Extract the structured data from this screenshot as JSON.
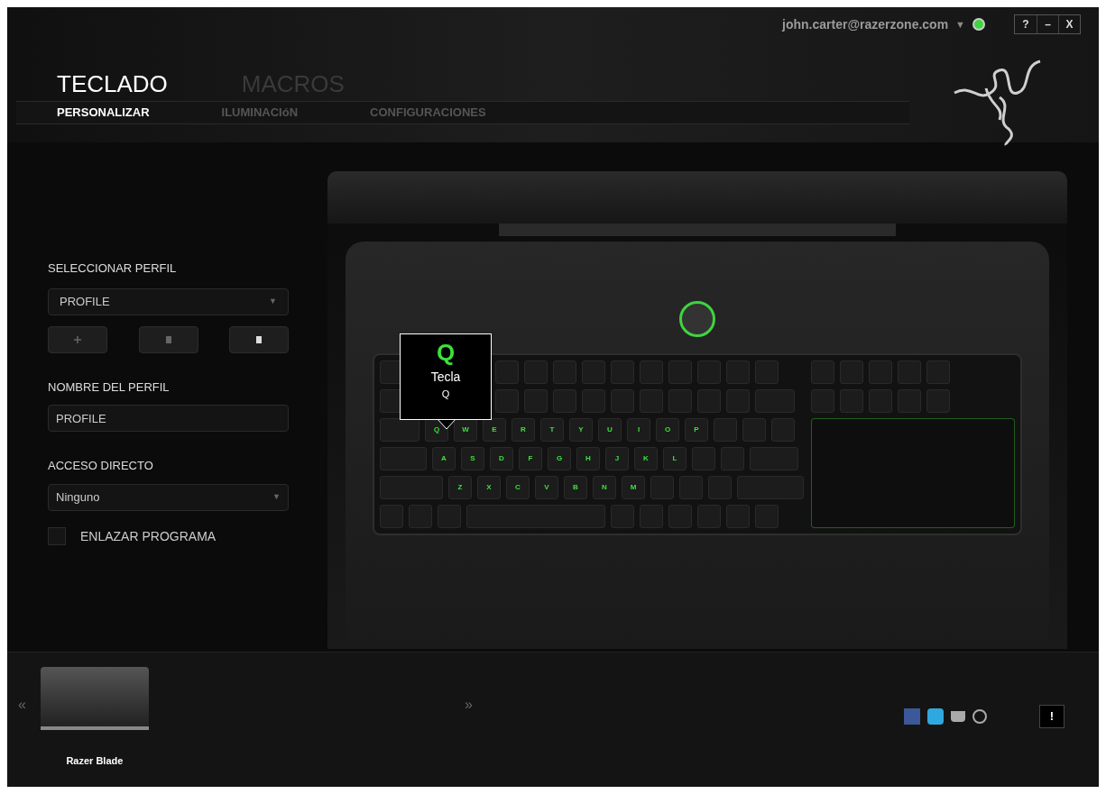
{
  "account": {
    "email": "john.carter@razerzone.com",
    "online": true
  },
  "account_caret": "▼",
  "dropdown_caret": "▼",
  "window_buttons": [
    "?",
    "–",
    "X"
  ],
  "tabs": [
    {
      "label": "TECLADO",
      "selected": true
    },
    {
      "label": "MACROS",
      "selected": false
    }
  ],
  "subtabs": [
    {
      "label": "PERSONALIZAR",
      "selected": true
    },
    {
      "label": "ILUMINACIóN",
      "selected": false
    },
    {
      "label": "CONFIGURACIONES",
      "selected": false
    }
  ],
  "profile": {
    "select_label": "SELECCIONAR PERFIL",
    "selected_profile": "PROFILE",
    "name_label": "NOMBRE DEL PERFIL",
    "name_value": "PROFILE",
    "shortcut_label": "ACCESO DIRECTO",
    "shortcut_value": "Ninguno",
    "link_program": {
      "label": "ENLAZAR PROGRAMA",
      "checked": false
    }
  },
  "keyboard": {
    "rows": [
      [
        "Q",
        "W",
        "E",
        "R",
        "T",
        "Y",
        "U",
        "I",
        "O",
        "P"
      ],
      [
        "A",
        "S",
        "D",
        "F",
        "G",
        "H",
        "J",
        "K",
        "L"
      ],
      [
        "Z",
        "X",
        "C",
        "V",
        "B",
        "N",
        "M"
      ]
    ]
  },
  "tooltip": {
    "key": "Q",
    "title": "Tecla",
    "subtitle": "Q"
  },
  "devices": [
    {
      "name": "Razer Blade",
      "selected": true
    }
  ],
  "nav": {
    "prev": "«",
    "next": "»"
  },
  "alert_button": "!"
}
